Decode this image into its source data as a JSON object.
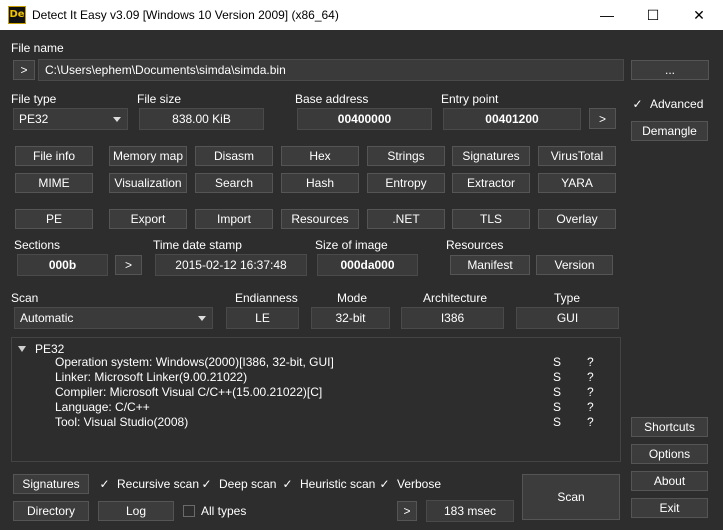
{
  "window": {
    "title": "Detect It Easy v3.09 [Windows 10 Version 2009] (x86_64)",
    "logo_text": "De",
    "minimize": "—",
    "maximize": "☐",
    "close": "✕"
  },
  "file": {
    "label": "File name",
    "browse_arrow": ">",
    "path": "C:\\Users\\ephem\\Documents\\simda\\simda.bin",
    "browse_button": "..."
  },
  "info": {
    "file_type_label": "File type",
    "file_type_value": "PE32",
    "file_size_label": "File size",
    "file_size_value": "838.00 KiB",
    "base_address_label": "Base address",
    "base_address_value": "00400000",
    "entry_point_label": "Entry point",
    "entry_point_value": "00401200",
    "entry_arrow": ">"
  },
  "tools_row1": [
    "File info",
    "Memory map",
    "Disasm",
    "Hex",
    "Strings",
    "Signatures",
    "VirusTotal"
  ],
  "tools_row2": [
    "MIME",
    "Visualization",
    "Search",
    "Hash",
    "Entropy",
    "Extractor",
    "YARA"
  ],
  "pe_row": [
    "PE",
    "Export",
    "Import",
    "Resources",
    ".NET",
    "TLS",
    "Overlay"
  ],
  "pe_info": {
    "sections_label": "Sections",
    "sections_value": "000b",
    "sections_arrow": ">",
    "timestamp_label": "Time date stamp",
    "timestamp_value": "2015-02-12 16:37:48",
    "image_size_label": "Size of image",
    "image_size_value": "000da000",
    "resources_label": "Resources",
    "manifest_button": "Manifest",
    "version_button": "Version"
  },
  "scan": {
    "label": "Scan",
    "mode_value": "Automatic",
    "endianness_label": "Endianness",
    "endianness_value": "LE",
    "mode_label": "Mode",
    "mode_bits": "32-bit",
    "arch_label": "Architecture",
    "arch_value": "I386",
    "type_label": "Type",
    "type_value": "GUI"
  },
  "results": {
    "root": "PE32",
    "rows": [
      {
        "text": "Operation system: Windows(2000)[I386, 32-bit, GUI]",
        "s": "S",
        "q": "?"
      },
      {
        "text": "Linker: Microsoft Linker(9.00.21022)",
        "s": "S",
        "q": "?"
      },
      {
        "text": "Compiler: Microsoft Visual C/C++(15.00.21022)[C]",
        "s": "S",
        "q": "?"
      },
      {
        "text": "Language: C/C++",
        "s": "S",
        "q": "?"
      },
      {
        "text": "Tool: Visual Studio(2008)",
        "s": "S",
        "q": "?"
      }
    ]
  },
  "right_panel": {
    "advanced_mark": "✓",
    "advanced_label": "Advanced",
    "demangle": "Demangle",
    "shortcuts": "Shortcuts",
    "options": "Options",
    "about": "About",
    "exit": "Exit"
  },
  "bottom": {
    "signatures_button": "Signatures",
    "recursive_label": "Recursive scan",
    "deep_label": "Deep scan",
    "heuristic_label": "Heuristic scan",
    "verbose_label": "Verbose",
    "check_mark": "✓",
    "directory_button": "Directory",
    "log_button": "Log",
    "all_types_label": "All types",
    "time_arrow": ">",
    "time_value": "183 msec",
    "scan_button": "Scan"
  }
}
